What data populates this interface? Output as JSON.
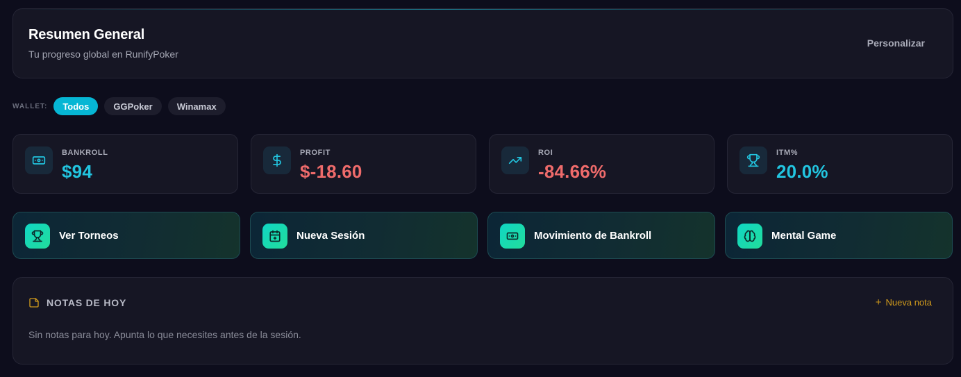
{
  "header": {
    "title": "Resumen General",
    "subtitle": "Tu progreso global en RunifyPoker",
    "customize_label": "Personalizar"
  },
  "wallet": {
    "label": "WALLET:",
    "options": [
      {
        "label": "Todos",
        "active": true
      },
      {
        "label": "GGPoker",
        "active": false
      },
      {
        "label": "Winamax",
        "active": false
      }
    ]
  },
  "stats": [
    {
      "label": "BANKROLL",
      "value": "$94",
      "color": "#22c5e0",
      "icon": "banknote-icon"
    },
    {
      "label": "PROFIT",
      "value": "$-18.60",
      "color": "#ef6b6b",
      "icon": "dollar-icon"
    },
    {
      "label": "ROI",
      "value": "-84.66%",
      "color": "#ef6b6b",
      "icon": "trending-up-icon"
    },
    {
      "label": "ITM%",
      "value": "20.0%",
      "color": "#22c5e0",
      "icon": "trophy-icon"
    }
  ],
  "actions": [
    {
      "label": "Ver Torneos",
      "icon": "trophy-icon"
    },
    {
      "label": "Nueva Sesión",
      "icon": "calendar-plus-icon"
    },
    {
      "label": "Movimiento de Bankroll",
      "icon": "banknote-icon"
    },
    {
      "label": "Mental Game",
      "icon": "brain-icon"
    }
  ],
  "notes": {
    "title": "NOTAS DE HOY",
    "new_note_label": "Nueva nota",
    "empty_text": "Sin notas para hoy. Apunta lo que necesites antes de la sesión."
  },
  "colors": {
    "accent": "#06b6d4",
    "negative": "#ef6b6b",
    "note_accent": "#d09a1c"
  }
}
